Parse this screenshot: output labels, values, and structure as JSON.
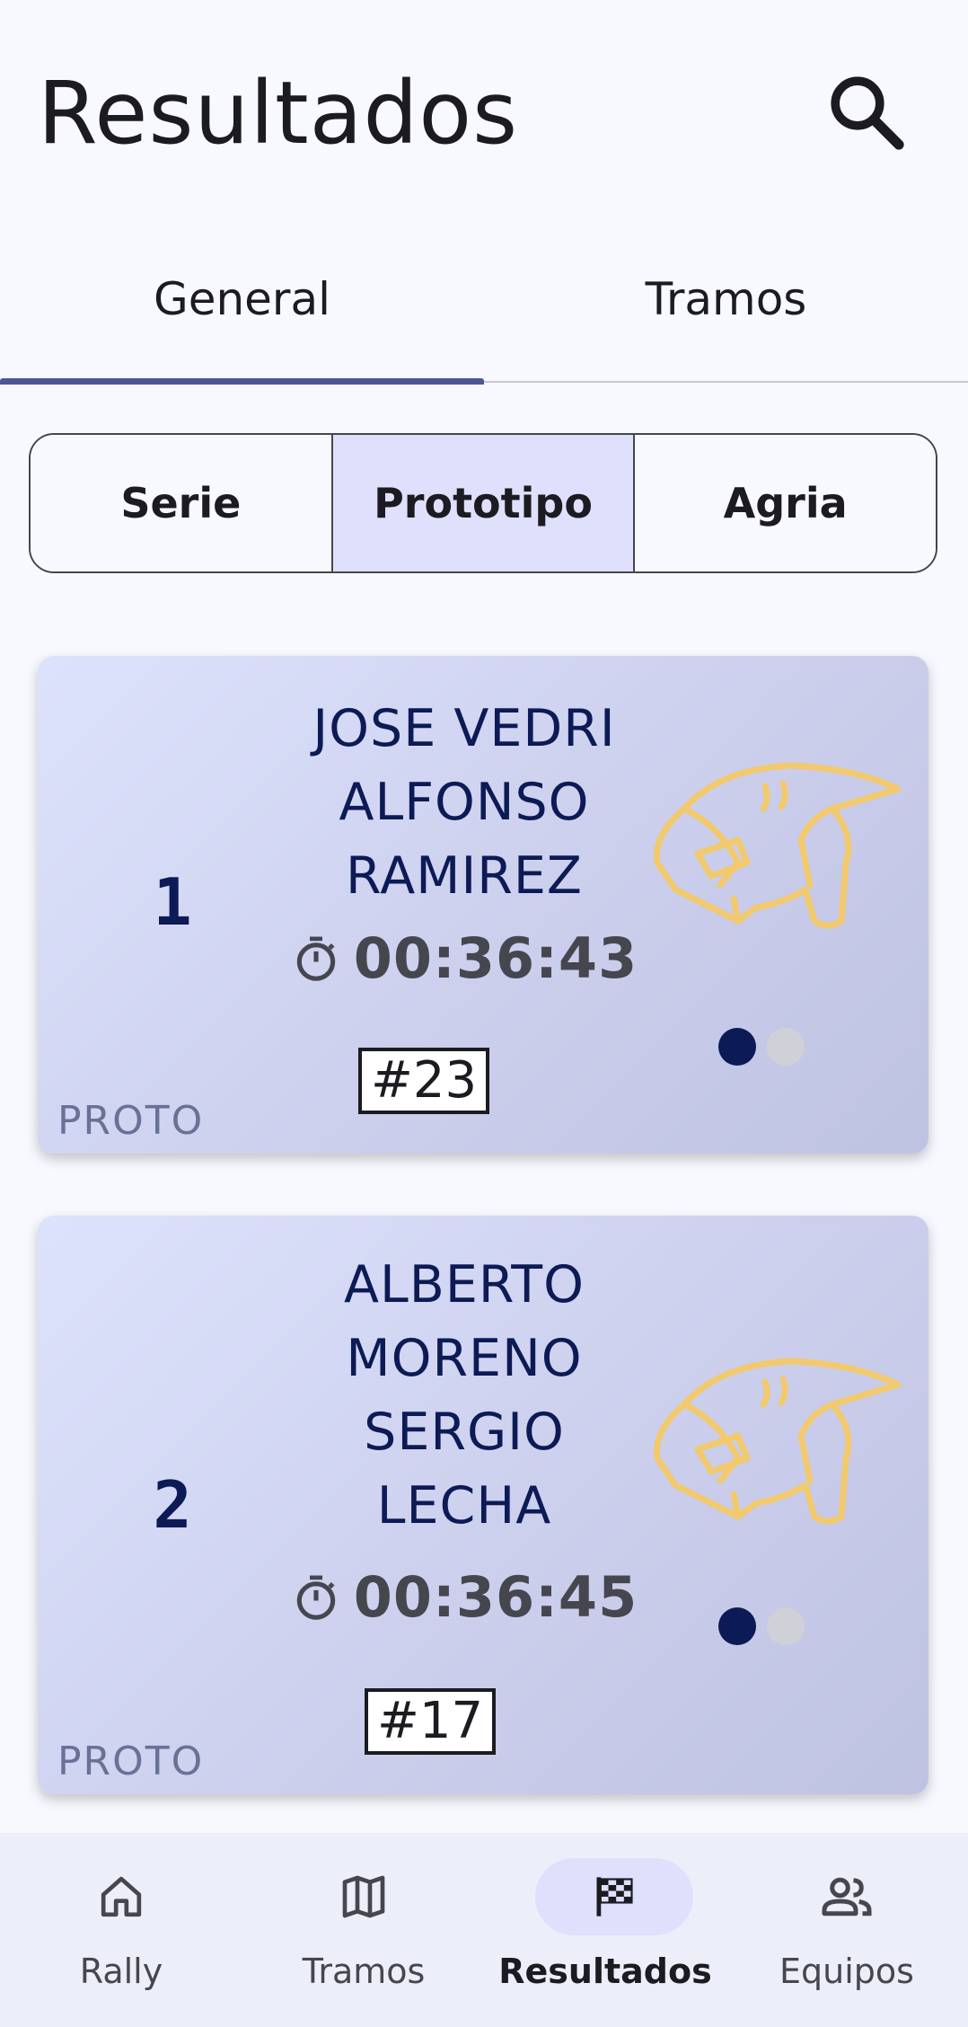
{
  "app_bar": {
    "title": "Resultados"
  },
  "tabs": [
    {
      "label": "General",
      "selected": true
    },
    {
      "label": "Tramos",
      "selected": false
    }
  ],
  "category_filter": [
    {
      "label": "Serie",
      "selected": false
    },
    {
      "label": "Prototipo",
      "selected": true
    },
    {
      "label": "Agria",
      "selected": false
    }
  ],
  "results": [
    {
      "position": "1",
      "driver": "JOSE VEDRI",
      "codriver": "ALFONSO RAMIREZ",
      "names_lines": [
        "JOSE VEDRI",
        "ALFONSO",
        "RAMIREZ"
      ],
      "time": "00:36:43",
      "bib": "#23",
      "category": "PROTO",
      "page_indicator": {
        "active": 1,
        "total": 2
      }
    },
    {
      "position": "2",
      "driver": "ALBERTO MORENO",
      "codriver": "SERGIO LECHA",
      "names_lines": [
        "ALBERTO",
        "MORENO",
        "SERGIO",
        "LECHA"
      ],
      "time": "00:36:45",
      "bib": "#17",
      "category": "PROTO",
      "page_indicator": {
        "active": 1,
        "total": 2
      }
    }
  ],
  "bottom_nav": [
    {
      "label": "Rally",
      "icon": "home-icon",
      "selected": false
    },
    {
      "label": "Tramos",
      "icon": "map-icon",
      "selected": false
    },
    {
      "label": "Resultados",
      "icon": "checkered-flag-icon",
      "selected": true
    },
    {
      "label": "Equipos",
      "icon": "people-icon",
      "selected": false
    }
  ],
  "colors": {
    "primary": "#4c5595",
    "card_text": "#0c1a55",
    "helmet": "#f2c96d",
    "selected_container": "#dfe0fb"
  }
}
